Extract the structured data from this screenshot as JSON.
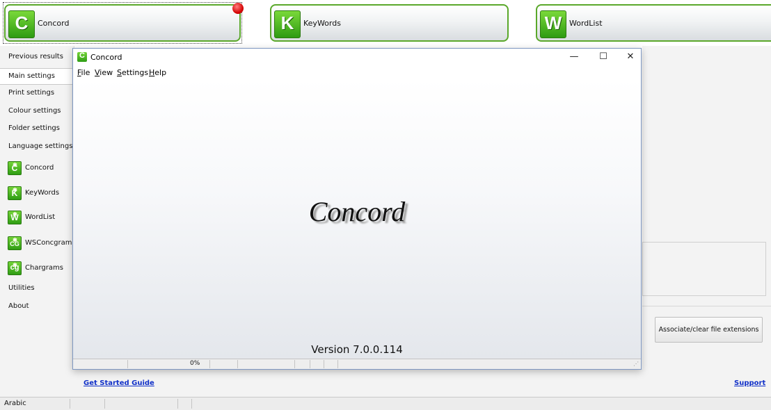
{
  "toolbar": {
    "buttons": [
      {
        "letter": "C",
        "label": "Concord"
      },
      {
        "letter": "K",
        "label": "KeyWords"
      },
      {
        "letter": "W",
        "label": "WordList"
      }
    ]
  },
  "sidebar": {
    "items": [
      {
        "label": "Previous results"
      },
      {
        "label": "Main settings",
        "selected": true
      },
      {
        "label": "Print settings"
      },
      {
        "label": "Colour settings"
      },
      {
        "label": "Folder settings"
      },
      {
        "label": "Language settings"
      }
    ],
    "apps": [
      {
        "letter": "C",
        "label": "Concord",
        "icon": "concord-icon"
      },
      {
        "letter": "K",
        "label": "KeyWords",
        "icon": "keywords-icon"
      },
      {
        "letter": "W",
        "label": "WordList",
        "icon": "wordlist-icon"
      },
      {
        "letter": "CG",
        "label": "WSConcgram",
        "icon": "wsconcgram-icon"
      },
      {
        "letter": "cg",
        "label": "Chargrams",
        "icon": "chargrams-icon"
      }
    ],
    "footer_items": [
      {
        "label": "Utilities"
      },
      {
        "label": "About"
      }
    ]
  },
  "window": {
    "icon_letter": "C",
    "title": "Concord",
    "controls": {
      "minimize": "—",
      "maximize": "☐",
      "close": "✕"
    },
    "menu": [
      {
        "accel": "F",
        "rest": "ile"
      },
      {
        "accel": "V",
        "rest": "iew"
      },
      {
        "accel": "S",
        "rest": "ettings"
      },
      {
        "accel": "H",
        "rest": "elp"
      }
    ],
    "splash_title": "Concord",
    "version": "Version 7.0.0.114",
    "status_progress": "0%"
  },
  "right_panel": {
    "associate_button": "Associate/clear file extensions"
  },
  "links": {
    "get_started": "Get Started Guide",
    "support": "Support"
  },
  "statusbar": {
    "language": "Arabic"
  },
  "colors": {
    "accent_green": "#3a9c1a",
    "link_blue": "#1030c8",
    "notification_red": "#d40000"
  }
}
